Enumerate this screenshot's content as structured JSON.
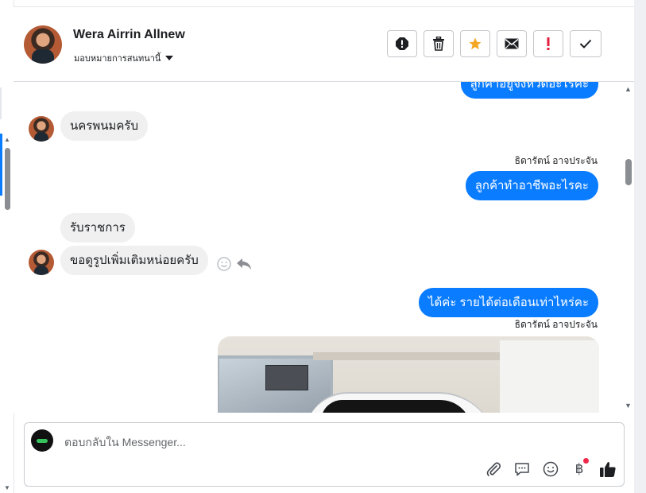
{
  "header": {
    "contact_name": "Wera Airrin Allnew",
    "assign_label": "มอบหมายการสนทนานี้"
  },
  "actions": [
    {
      "name": "report-icon"
    },
    {
      "name": "trash-icon"
    },
    {
      "name": "star-icon"
    },
    {
      "name": "mail-icon"
    },
    {
      "name": "exclamation-icon"
    },
    {
      "name": "check-icon"
    }
  ],
  "messages": [
    {
      "id": 0,
      "side": "out",
      "text": "ลูกค้าอยู่จังหวัดอะไรคะ"
    },
    {
      "id": 1,
      "side": "in",
      "text": "นครพนมครับ"
    },
    {
      "id": 2,
      "side": "out",
      "sender": "ธิดารัตน์ อาจประจัน",
      "text": "ลูกค้าทำอาชีพอะไรคะ"
    },
    {
      "id": 3,
      "side": "in",
      "text": "รับราชการ"
    },
    {
      "id": 4,
      "side": "in",
      "text": "ขอดูรูปเพิ่มเติมหน่อยครับ"
    },
    {
      "id": 5,
      "side": "out",
      "text": "ได้ค่ะ รายได้ต่อเดือนเท่าไหร่คะ"
    },
    {
      "id": 6,
      "side": "out",
      "sender": "ธิดารัตน์ อาจประจัน",
      "type": "photo"
    }
  ],
  "composer": {
    "placeholder": "ตอบกลับใน Messenger..."
  },
  "colors": {
    "outgoing_bubble": "#0a7cff",
    "incoming_bubble": "#f0f0f0",
    "star": "#f5a623",
    "exclamation": "#e41e3f",
    "notify_dot": "#f02849"
  }
}
